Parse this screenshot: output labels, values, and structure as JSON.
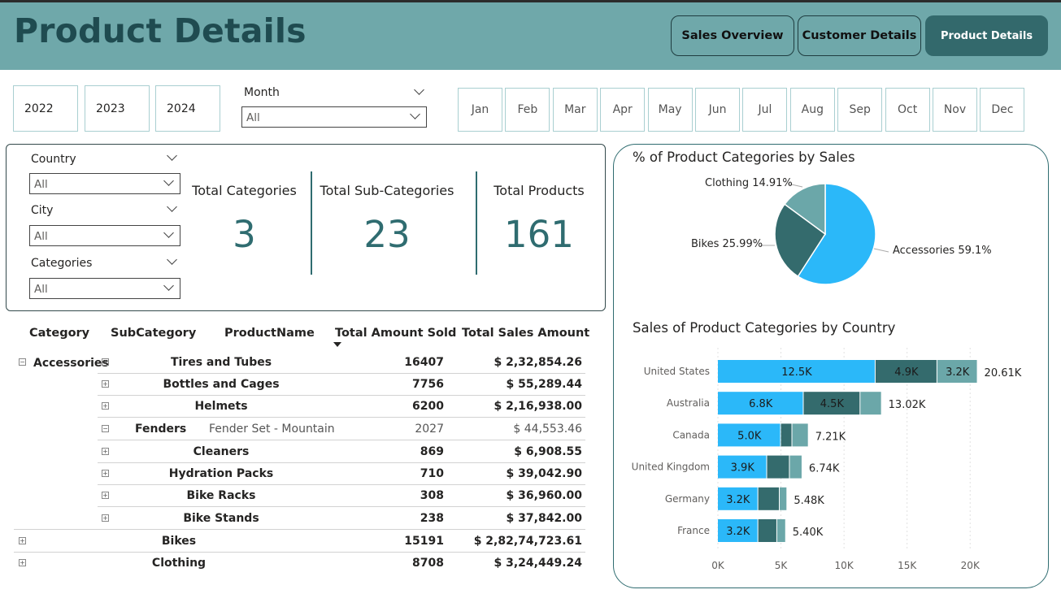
{
  "header": {
    "title": "Product Details",
    "nav": [
      {
        "label": "Sales Overview",
        "active": false
      },
      {
        "label": "Customer Details",
        "active": false
      },
      {
        "label": "Product Details",
        "active": true
      }
    ]
  },
  "slicers": {
    "years": [
      "2022",
      "2023",
      "2024"
    ],
    "month": {
      "label": "Month",
      "value": "All"
    },
    "months": [
      "Jan",
      "Feb",
      "Mar",
      "Apr",
      "May",
      "Jun",
      "Jul",
      "Aug",
      "Sep",
      "Oct",
      "Nov",
      "Dec"
    ],
    "country": {
      "label": "Country",
      "value": "All"
    },
    "city": {
      "label": "City",
      "value": "All"
    },
    "categories": {
      "label": "Categories",
      "value": "All"
    }
  },
  "kpis": [
    {
      "label": "Total Categories",
      "value": "3"
    },
    {
      "label": "Total Sub-Categories",
      "value": "23"
    },
    {
      "label": "Total Products",
      "value": "161"
    }
  ],
  "table": {
    "headers": {
      "category": "Category",
      "subcategory": "SubCategory",
      "product": "ProductName",
      "amount": "Total Amount Sold",
      "sales": "Total Sales Amount"
    },
    "rows": [
      {
        "category": "Accessories",
        "subcategory": "Tires and Tubes",
        "amount": "16407",
        "sales": "$ 2,32,854.26"
      },
      {
        "subcategory": "Bottles and Cages",
        "amount": "7756",
        "sales": "$ 55,289.44"
      },
      {
        "subcategory": "Helmets",
        "amount": "6200",
        "sales": "$ 2,16,938.00"
      },
      {
        "subcategory": "Fenders",
        "product": "Fender Set - Mountain",
        "amount": "2027",
        "sales": "$ 44,553.46"
      },
      {
        "subcategory": "Cleaners",
        "amount": "869",
        "sales": "$ 6,908.55"
      },
      {
        "subcategory": "Hydration Packs",
        "amount": "710",
        "sales": "$ 39,042.90"
      },
      {
        "subcategory": "Bike Racks",
        "amount": "308",
        "sales": "$ 36,960.00"
      },
      {
        "subcategory": "Bike Stands",
        "amount": "238",
        "sales": "$ 37,842.00"
      },
      {
        "category": "Bikes",
        "amount": "15191",
        "sales": "$ 2,82,74,723.61"
      },
      {
        "category": "Clothing",
        "amount": "8708",
        "sales": "$ 3,24,449.24"
      }
    ]
  },
  "colors": {
    "accent": "#6fa8aa",
    "dark": "#33696c",
    "accessories": "#2bb8f9",
    "bikes": "#346b6d",
    "clothing": "#6ba7a9"
  },
  "chart_data": [
    {
      "type": "pie",
      "title": "% of Product Categories by Sales",
      "slices": [
        {
          "label": "Accessories",
          "value": 59.1,
          "display": "Accessories 59.1%",
          "color": "#2bb8f9"
        },
        {
          "label": "Bikes",
          "value": 25.99,
          "display": "Bikes 25.99%",
          "color": "#346b6d"
        },
        {
          "label": "Clothing",
          "value": 14.91,
          "display": "Clothing 14.91%",
          "color": "#6ba7a9"
        }
      ]
    },
    {
      "type": "bar",
      "orientation": "horizontal",
      "stacked": true,
      "title": "Sales of Product Categories by Country",
      "categories": [
        "United States",
        "Australia",
        "Canada",
        "United Kingdom",
        "Germany",
        "France"
      ],
      "series": [
        {
          "color": "#2bb8f9",
          "values": [
            12.5,
            6.8,
            5.0,
            3.9,
            3.2,
            3.2
          ],
          "labels": [
            "12.5K",
            "6.8K",
            "5.0K",
            "3.9K",
            "3.2K",
            "3.2K"
          ]
        },
        {
          "color": "#346b6d",
          "values": [
            4.9,
            4.5,
            0.9,
            1.8,
            1.7,
            1.5
          ],
          "labels": [
            "4.9K",
            "4.5K",
            "",
            "",
            "",
            ""
          ]
        },
        {
          "color": "#6ba7a9",
          "values": [
            3.2,
            1.7,
            1.3,
            1.0,
            0.6,
            0.7
          ],
          "labels": [
            "3.2K",
            "",
            "",
            "",
            "",
            ""
          ]
        }
      ],
      "totals": [
        "20.61K",
        "13.02K",
        "7.21K",
        "6.74K",
        "5.48K",
        "5.40K"
      ],
      "xlim": [
        0,
        20.5
      ],
      "xticks": [
        {
          "v": 0,
          "label": "0K"
        },
        {
          "v": 5,
          "label": "5K"
        },
        {
          "v": 10,
          "label": "10K"
        },
        {
          "v": 15,
          "label": "15K"
        },
        {
          "v": 20,
          "label": "20K"
        }
      ],
      "grid": true
    }
  ]
}
